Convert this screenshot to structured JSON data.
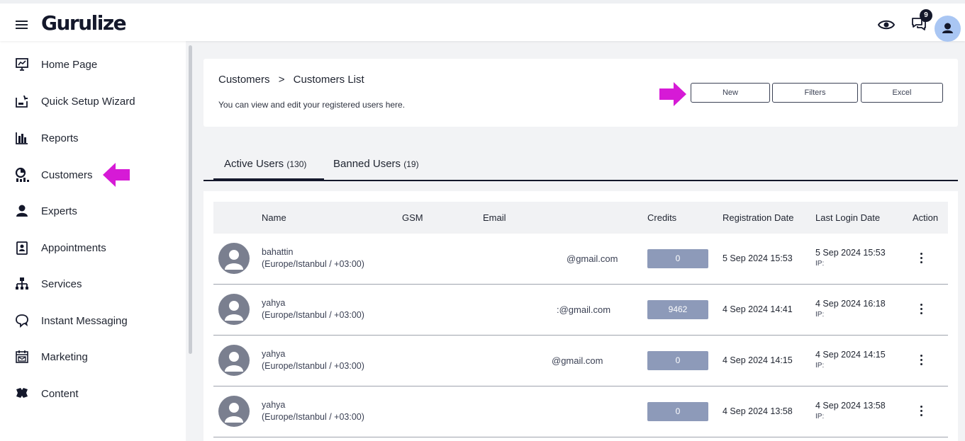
{
  "header": {
    "logo": "Gurulize",
    "notification_count": "9"
  },
  "sidebar": {
    "items": [
      {
        "label": "Home Page",
        "icon": "monitor-chart-icon"
      },
      {
        "label": "Quick Setup Wizard",
        "icon": "wizard-icon"
      },
      {
        "label": "Reports",
        "icon": "bar-chart-icon"
      },
      {
        "label": "Customers",
        "icon": "customers-icon"
      },
      {
        "label": "Experts",
        "icon": "person-icon"
      },
      {
        "label": "Appointments",
        "icon": "appointment-icon"
      },
      {
        "label": "Services",
        "icon": "hierarchy-icon"
      },
      {
        "label": "Instant Messaging",
        "icon": "chat-icon"
      },
      {
        "label": "Marketing",
        "icon": "calendar-mail-icon"
      },
      {
        "label": "Content",
        "icon": "puzzle-icon"
      }
    ]
  },
  "page": {
    "breadcrumb_root": "Customers",
    "breadcrumb_sep": ">",
    "breadcrumb_current": "Customers List",
    "subtitle": "You can view and edit your registered users here.",
    "buttons": {
      "new": "New",
      "filters": "Filters",
      "excel": "Excel"
    }
  },
  "tabs": [
    {
      "label": "Active Users",
      "count": "(130)"
    },
    {
      "label": "Banned Users",
      "count": "(19)"
    }
  ],
  "table": {
    "columns": [
      "Name",
      "GSM",
      "Email",
      "Credits",
      "Registration Date",
      "Last Login Date",
      "Action"
    ],
    "rows": [
      {
        "name": "bahattin",
        "timezone": "(Europe/Istanbul / +03:00)",
        "email": "@gmail.com",
        "credits": "0",
        "registration": "5 Sep 2024 15:53",
        "last_login": "5 Sep 2024 15:53",
        "ip": "IP:"
      },
      {
        "name": "yahya",
        "timezone": "(Europe/Istanbul / +03:00)",
        "email": ":@gmail.com",
        "credits": "9462",
        "registration": "4 Sep 2024 14:41",
        "last_login": "4 Sep 2024 16:18",
        "ip": "IP:"
      },
      {
        "name": "yahya",
        "timezone": "(Europe/Istanbul / +03:00)",
        "email": "@gmail.com",
        "credits": "0",
        "registration": "4 Sep 2024 14:15",
        "last_login": "4 Sep 2024 14:15",
        "ip": "IP:"
      },
      {
        "name": "yahya",
        "timezone": "(Europe/Istanbul / +03:00)",
        "email": "",
        "credits": "0",
        "registration": "4 Sep 2024 13:58",
        "last_login": "4 Sep 2024 13:58",
        "ip": "IP:"
      }
    ]
  },
  "colors": {
    "brand_dark": "#14182b",
    "credit_badge": "#8d9ab9",
    "annotation_arrow": "#d61ad6",
    "avatar_top": "#a9c6f3"
  }
}
